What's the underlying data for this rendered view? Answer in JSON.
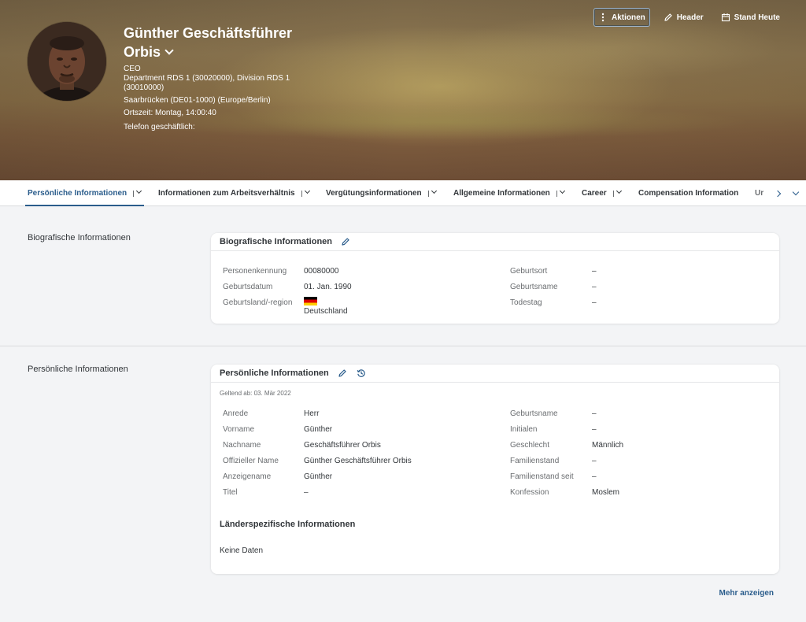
{
  "header": {
    "name_line1": "Günther Geschäftsführer",
    "name_line2": "Orbis",
    "role": "CEO",
    "department": "Department RDS 1 (30020000), Division RDS 1 (30010000)",
    "location": "Saarbrücken (DE01-1000) (Europe/Berlin)",
    "local_time": "Ortszeit: Montag, 14:00:40",
    "phone_label": "Telefon geschäftlich:",
    "phone_value": "",
    "email": "",
    "actions": {
      "actions_label": "Aktionen",
      "header_label": "Header",
      "date_label": "Stand Heute"
    }
  },
  "tabs": [
    {
      "label": "Persönliche Informationen",
      "active": true
    },
    {
      "label": "Informationen zum Arbeitsverhältnis"
    },
    {
      "label": "Vergütungsinformationen"
    },
    {
      "label": "Allgemeine Informationen"
    },
    {
      "label": "Career"
    },
    {
      "label": "Compensation Information"
    },
    {
      "label": "Ur"
    }
  ],
  "bio": {
    "section_label": "Biografische Informationen",
    "card_title": "Biografische Informationen",
    "fields_left": [
      {
        "label": "Personenkennung",
        "value": "00080000"
      },
      {
        "label": "Geburtsdatum",
        "value": "01. Jan. 1990"
      },
      {
        "label": "Geburtsland/-region",
        "value": "Deutschland",
        "flag": "de"
      }
    ],
    "fields_right": [
      {
        "label": "Geburtsort",
        "value": "–"
      },
      {
        "label": "Geburtsname",
        "value": "–"
      },
      {
        "label": "Todestag",
        "value": "–"
      }
    ]
  },
  "personal": {
    "section_label": "Persönliche Informationen",
    "card_title": "Persönliche Informationen",
    "valid_from": "Geltend ab: 03. Mär 2022",
    "fields_left": [
      {
        "label": "Anrede",
        "value": "Herr"
      },
      {
        "label": "Vorname",
        "value": "Günther"
      },
      {
        "label": "Nachname",
        "value": "Geschäftsführer Orbis"
      },
      {
        "label": "Offizieller Name",
        "value": "Günther Geschäftsführer Orbis"
      },
      {
        "label": "Anzeigename",
        "value": "Günther"
      },
      {
        "label": "Titel",
        "value": "–"
      }
    ],
    "fields_right": [
      {
        "label": "Geburtsname",
        "value": "–"
      },
      {
        "label": "Initialen",
        "value": "–"
      },
      {
        "label": "Geschlecht",
        "value": "Männlich"
      },
      {
        "label": "Familienstand",
        "value": "–"
      },
      {
        "label": "Familienstand seit",
        "value": "–"
      },
      {
        "label": "Konfession",
        "value": "Moslem"
      }
    ],
    "country_title": "Länderspezifische Informationen",
    "country_empty": "Keine Daten"
  },
  "more_label": "Mehr anzeigen",
  "colors": {
    "accent": "#2b5d8c",
    "link": "#0a6ed1",
    "background": "#f3f4f6"
  }
}
